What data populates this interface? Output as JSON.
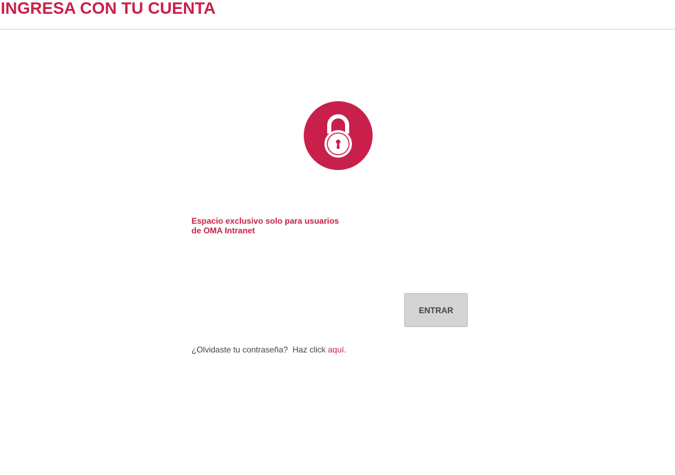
{
  "header": {
    "title": "INGRESA CON TU CUENTA"
  },
  "lock": {
    "icon": "padlock-icon",
    "badge_color": "#c8204a"
  },
  "notice": {
    "line1": "Espacio exclusivo solo para usuarios",
    "line2": "de OMA Intranet"
  },
  "form": {
    "submit_label": "ENTRAR"
  },
  "forgot": {
    "question": "¿Olvidaste tu contraseña?",
    "prompt": "Haz click",
    "link_label": "aquí",
    "trailing": "."
  },
  "colors": {
    "accent": "#c8204a",
    "button_bg": "#d4d4d4",
    "text": "#444444"
  }
}
